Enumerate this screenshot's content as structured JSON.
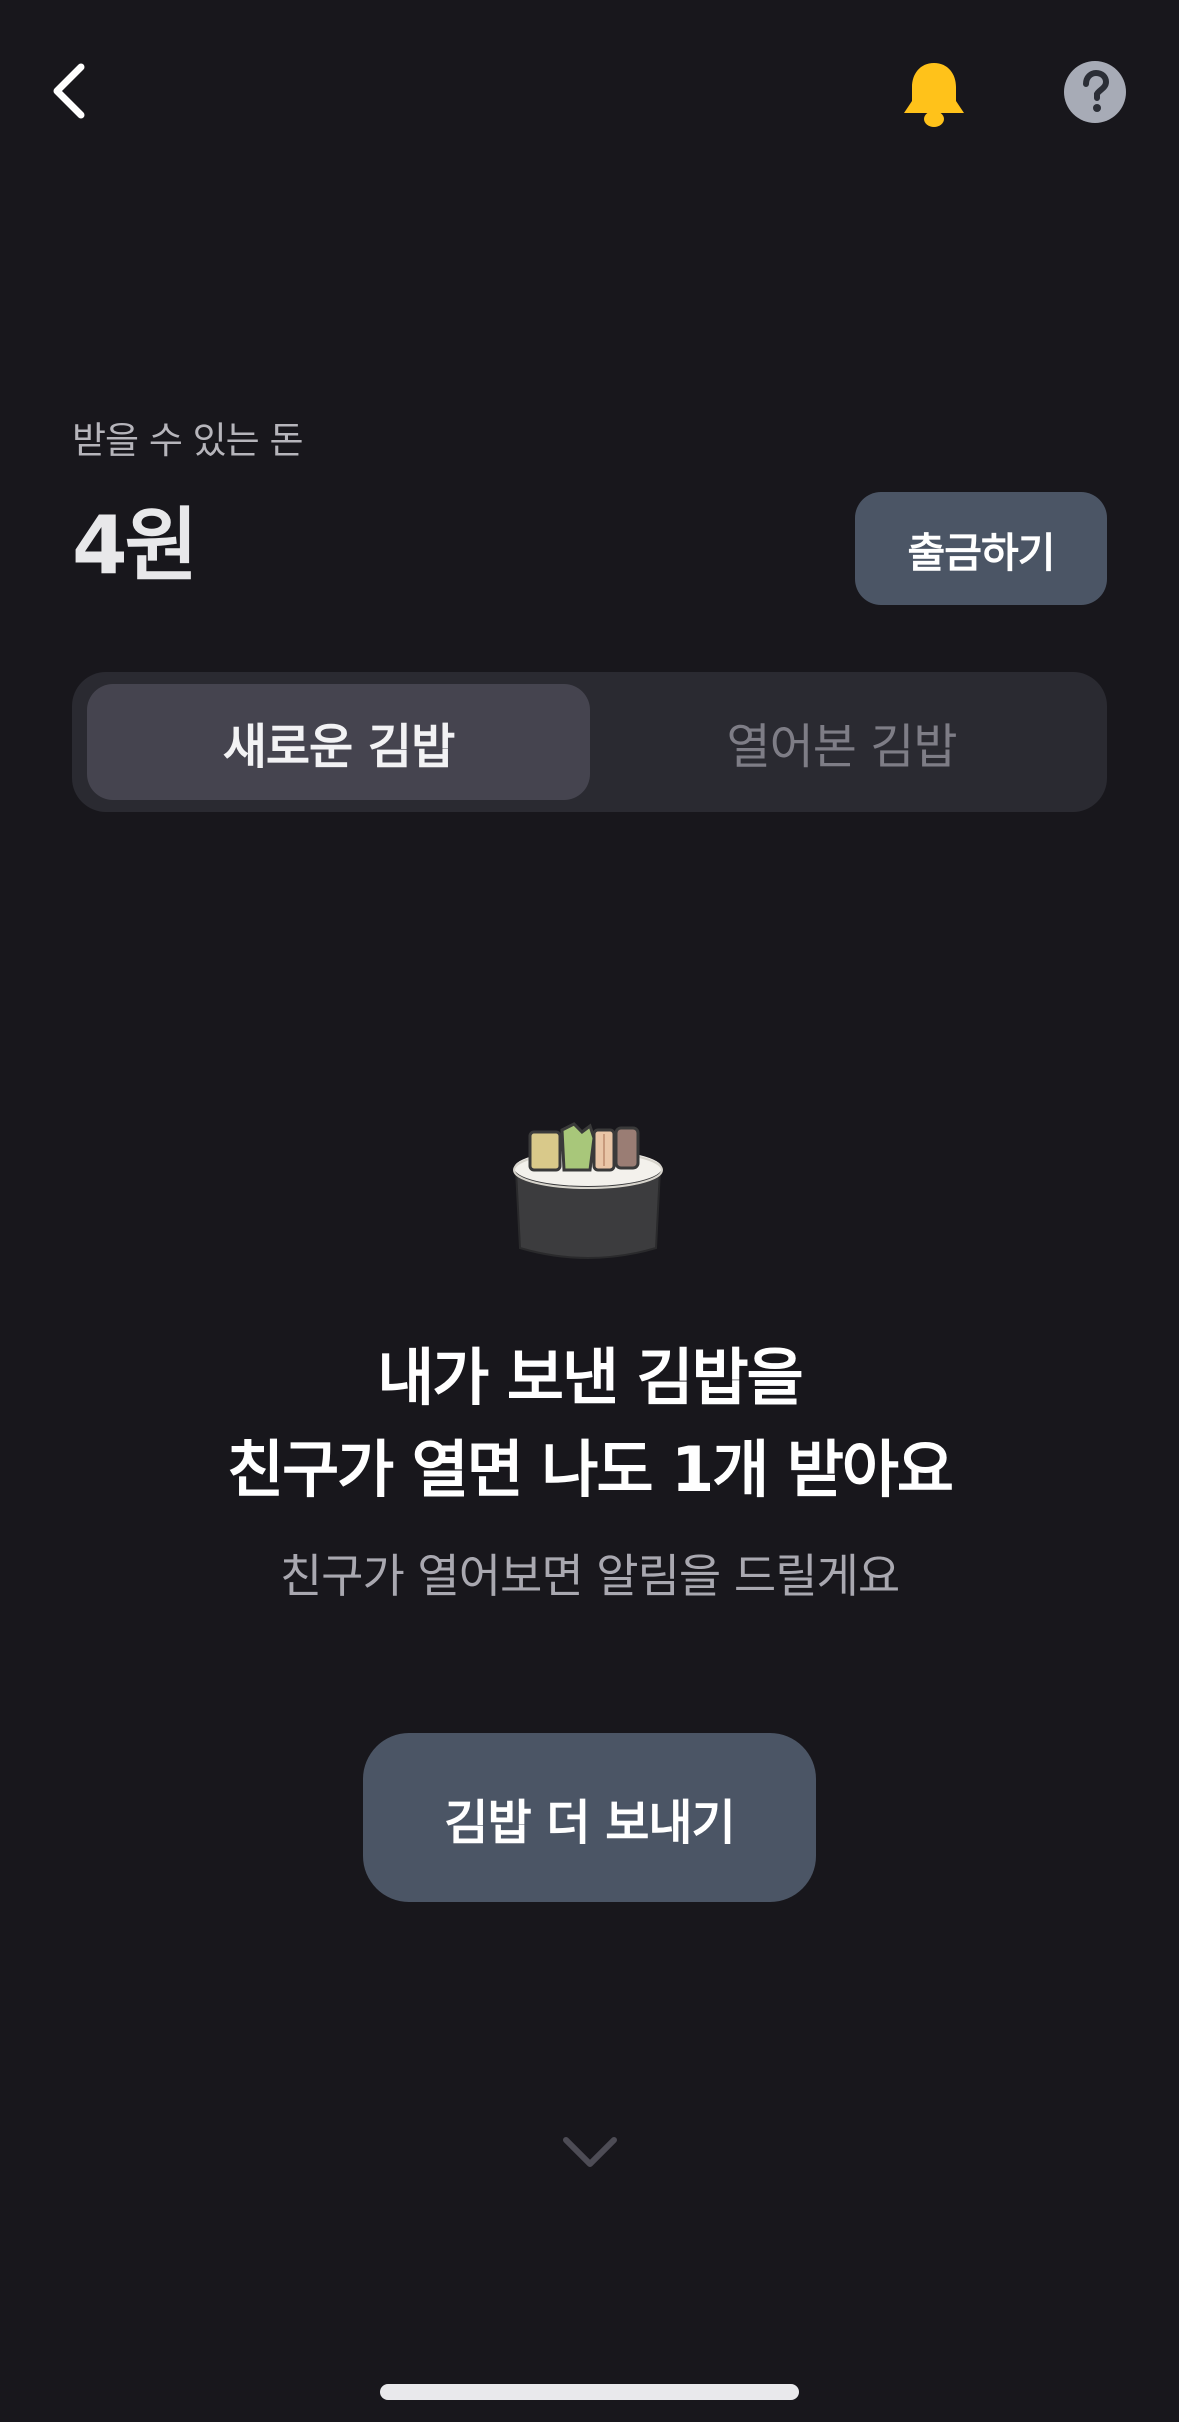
{
  "header": {
    "back_icon": "chevron-left-icon",
    "notification_icon": "bell-icon",
    "help_icon": "question-circle-icon",
    "colors": {
      "bell": "#ffc21a",
      "help_bg": "#a7abb6",
      "help_fg": "#2b2e36"
    }
  },
  "balance": {
    "label": "받을 수 있는 돈",
    "amount": "4원",
    "withdraw_label": "출금하기"
  },
  "tabs": [
    {
      "label": "새로운 김밥",
      "selected": true
    },
    {
      "label": "열어본 김밥",
      "selected": false
    }
  ],
  "empty_state": {
    "illustration_icon": "kimbap-icon",
    "headline_line1": "내가 보낸 김밥을",
    "headline_line2": "친구가 열면 나도 1개 받아요",
    "subtext": "친구가 열어보면 알림을 드릴게요",
    "cta_label": "김밥 더 보내기"
  },
  "footer": {
    "scroll_icon": "chevron-down-icon"
  },
  "colors": {
    "background": "#18171c",
    "button": "#4b5565",
    "tab_track": "#2a2a31",
    "tab_selected": "#45444f"
  }
}
